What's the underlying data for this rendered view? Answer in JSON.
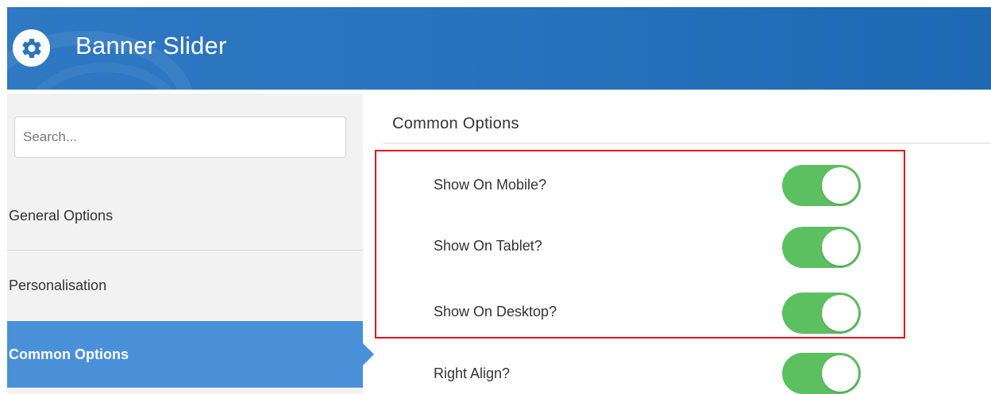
{
  "header": {
    "title": "Banner Slider",
    "icon": "gear-icon",
    "background_color": "#2a74bf"
  },
  "sidebar": {
    "search": {
      "placeholder": "Search...",
      "value": ""
    },
    "items": [
      {
        "label": "General Options",
        "active": false
      },
      {
        "label": "Personalisation",
        "active": false
      },
      {
        "label": "Common Options",
        "active": true
      }
    ],
    "active_color": "#4a90d9"
  },
  "main": {
    "section_title": "Common Options",
    "options": [
      {
        "label": "Show On Mobile?",
        "enabled": true
      },
      {
        "label": "Show On Tablet?",
        "enabled": true
      },
      {
        "label": "Show On Desktop?",
        "enabled": true
      },
      {
        "label": "Right Align?",
        "enabled": true
      }
    ],
    "toggle_on_color": "#5cbf60",
    "highlight_color": "#e0161f"
  }
}
